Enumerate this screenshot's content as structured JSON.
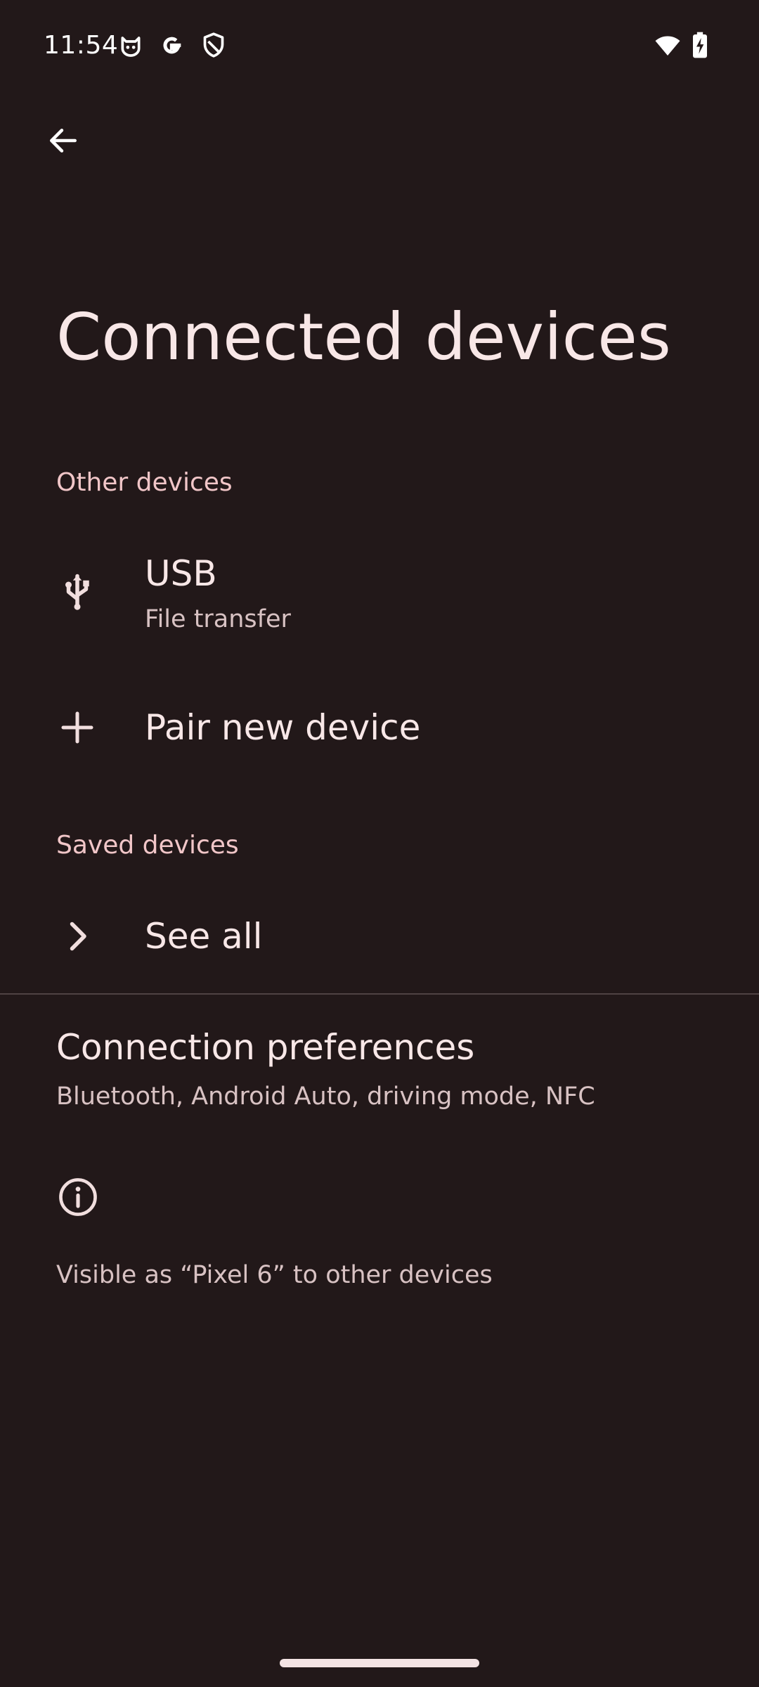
{
  "status_bar": {
    "time": "11:54",
    "icons": [
      "cat-face-icon",
      "google-g-icon",
      "shield-icon",
      "wifi-icon",
      "battery-charging-icon"
    ]
  },
  "navigation": {
    "back_icon": "arrow-back-icon"
  },
  "page": {
    "title": "Connected devices"
  },
  "other_devices": {
    "header": "Other devices",
    "usb": {
      "icon": "usb-icon",
      "title": "USB",
      "summary": "File transfer"
    },
    "pair": {
      "icon": "plus-icon",
      "title": "Pair new device"
    }
  },
  "saved_devices": {
    "header": "Saved devices",
    "see_all": {
      "icon": "chevron-right-icon",
      "title": "See all"
    }
  },
  "connection_preferences": {
    "title": "Connection preferences",
    "summary": "Bluetooth, Android Auto, driving mode, NFC"
  },
  "footer_info": {
    "icon": "info-icon",
    "text": "Visible as “Pixel 6” to other devices"
  },
  "colors": {
    "background": "#221819",
    "primary_text": "#f8e7e7",
    "secondary_text": "#d8c2c3",
    "section_header": "#f1c6c8",
    "divider": "#4f4243"
  }
}
